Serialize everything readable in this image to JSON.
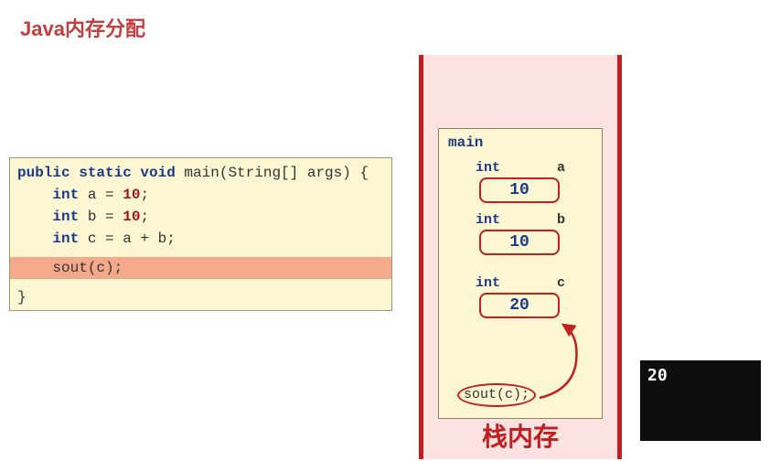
{
  "title": "Java内存分配",
  "code": {
    "line1_kw1": "public static void",
    "line1_name": " main(String[] args) {",
    "line2_kw": "int",
    "line2_rest": " a = ",
    "line2_val": "10",
    "line2_end": ";",
    "line3_kw": "int",
    "line3_rest": " b = ",
    "line3_val": "10",
    "line3_end": ";",
    "line4_kw": "int",
    "line4_rest": " c = a + b;",
    "line5": "    sout(c);",
    "line6": "}"
  },
  "stack": {
    "label": "栈内存",
    "frame_name": "main",
    "vars": [
      {
        "type": "int",
        "name": "a",
        "value": "10"
      },
      {
        "type": "int",
        "name": "b",
        "value": "10"
      },
      {
        "type": "int",
        "name": "c",
        "value": "20"
      }
    ],
    "call": "sout(c);"
  },
  "console_output": "20"
}
